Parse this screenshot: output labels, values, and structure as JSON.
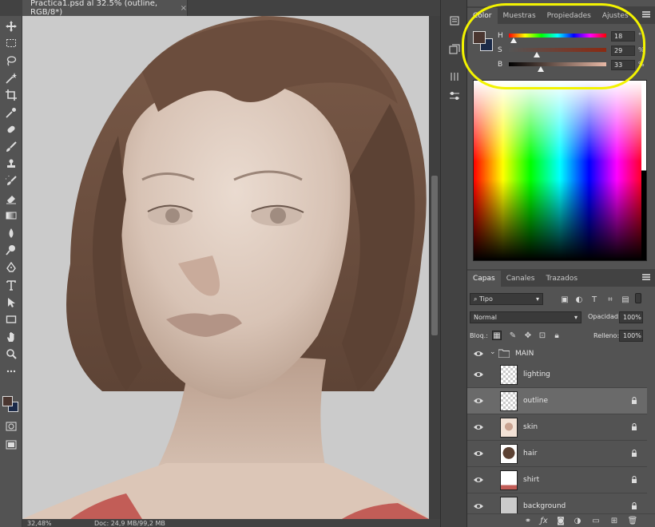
{
  "document": {
    "tab_title": "Practica1.psd al 32.5% (outline, RGB/8*)",
    "close": "×"
  },
  "status": {
    "zoom": "32,48%",
    "doc": "Doc: 24,9 MB/99,2 MB"
  },
  "toolbar": {
    "tools": [
      "move-icon",
      "marquee-icon",
      "lasso-icon",
      "magic-wand-icon",
      "crop-icon",
      "eyedropper-icon",
      "healing-icon",
      "brush-icon",
      "stamp-icon",
      "history-brush-icon",
      "eraser-icon",
      "gradient-icon",
      "blur-icon",
      "dodge-icon",
      "pen-icon",
      "type-icon",
      "path-select-icon",
      "rectangle-icon",
      "hand-icon",
      "zoom-icon",
      "more-icon"
    ],
    "foreground": "#4a3630",
    "background": "#1b2a48"
  },
  "color_panel": {
    "tabs": [
      "Color",
      "Muestras",
      "Propiedades",
      "Ajustes"
    ],
    "active_tab": "Color",
    "h": {
      "label": "H",
      "value": "18",
      "unit": "°",
      "level": 0.05
    },
    "s": {
      "label": "S",
      "value": "29",
      "unit": "%",
      "level": 0.29
    },
    "b": {
      "label": "B",
      "value": "33",
      "unit": "%",
      "level": 0.33
    },
    "swatch": "#4a3630"
  },
  "layers_panel": {
    "tabs": [
      "Capas",
      "Canales",
      "Trazados"
    ],
    "active_tab": "Capas",
    "filter": "Tipo",
    "blend_mode": "Normal",
    "opacity_label": "Opacidad:",
    "opacity": "100%",
    "lock_label": "Bloq.:",
    "fill_label": "Relleno:",
    "fill": "100%",
    "group": "MAIN",
    "layers": [
      {
        "name": "lighting",
        "locked": false,
        "selected": false,
        "thumb": "transparent"
      },
      {
        "name": "outline",
        "locked": true,
        "selected": true,
        "thumb": "transparent"
      },
      {
        "name": "skin",
        "locked": true,
        "selected": false,
        "thumb": "skin"
      },
      {
        "name": "hair",
        "locked": true,
        "selected": false,
        "thumb": "hair"
      },
      {
        "name": "shirt",
        "locked": true,
        "selected": false,
        "thumb": "shirt"
      },
      {
        "name": "background",
        "locked": true,
        "selected": false,
        "thumb": "gray"
      }
    ],
    "footer_icons": [
      "link-icon",
      "fx-icon",
      "mask-icon",
      "adjustment-icon",
      "folder-icon",
      "new-layer-icon",
      "trash-icon"
    ]
  },
  "annotation": {
    "color": "#f3f300"
  }
}
